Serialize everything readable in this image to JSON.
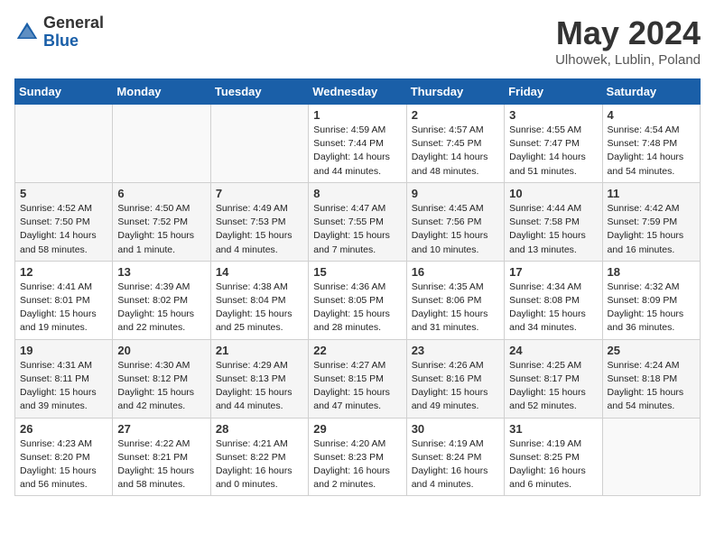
{
  "header": {
    "logo_general": "General",
    "logo_blue": "Blue",
    "month_title": "May 2024",
    "location": "Ulhowek, Lublin, Poland"
  },
  "weekdays": [
    "Sunday",
    "Monday",
    "Tuesday",
    "Wednesday",
    "Thursday",
    "Friday",
    "Saturday"
  ],
  "weeks": [
    [
      {
        "day": "",
        "info": ""
      },
      {
        "day": "",
        "info": ""
      },
      {
        "day": "",
        "info": ""
      },
      {
        "day": "1",
        "info": "Sunrise: 4:59 AM\nSunset: 7:44 PM\nDaylight: 14 hours\nand 44 minutes."
      },
      {
        "day": "2",
        "info": "Sunrise: 4:57 AM\nSunset: 7:45 PM\nDaylight: 14 hours\nand 48 minutes."
      },
      {
        "day": "3",
        "info": "Sunrise: 4:55 AM\nSunset: 7:47 PM\nDaylight: 14 hours\nand 51 minutes."
      },
      {
        "day": "4",
        "info": "Sunrise: 4:54 AM\nSunset: 7:48 PM\nDaylight: 14 hours\nand 54 minutes."
      }
    ],
    [
      {
        "day": "5",
        "info": "Sunrise: 4:52 AM\nSunset: 7:50 PM\nDaylight: 14 hours\nand 58 minutes."
      },
      {
        "day": "6",
        "info": "Sunrise: 4:50 AM\nSunset: 7:52 PM\nDaylight: 15 hours\nand 1 minute."
      },
      {
        "day": "7",
        "info": "Sunrise: 4:49 AM\nSunset: 7:53 PM\nDaylight: 15 hours\nand 4 minutes."
      },
      {
        "day": "8",
        "info": "Sunrise: 4:47 AM\nSunset: 7:55 PM\nDaylight: 15 hours\nand 7 minutes."
      },
      {
        "day": "9",
        "info": "Sunrise: 4:45 AM\nSunset: 7:56 PM\nDaylight: 15 hours\nand 10 minutes."
      },
      {
        "day": "10",
        "info": "Sunrise: 4:44 AM\nSunset: 7:58 PM\nDaylight: 15 hours\nand 13 minutes."
      },
      {
        "day": "11",
        "info": "Sunrise: 4:42 AM\nSunset: 7:59 PM\nDaylight: 15 hours\nand 16 minutes."
      }
    ],
    [
      {
        "day": "12",
        "info": "Sunrise: 4:41 AM\nSunset: 8:01 PM\nDaylight: 15 hours\nand 19 minutes."
      },
      {
        "day": "13",
        "info": "Sunrise: 4:39 AM\nSunset: 8:02 PM\nDaylight: 15 hours\nand 22 minutes."
      },
      {
        "day": "14",
        "info": "Sunrise: 4:38 AM\nSunset: 8:04 PM\nDaylight: 15 hours\nand 25 minutes."
      },
      {
        "day": "15",
        "info": "Sunrise: 4:36 AM\nSunset: 8:05 PM\nDaylight: 15 hours\nand 28 minutes."
      },
      {
        "day": "16",
        "info": "Sunrise: 4:35 AM\nSunset: 8:06 PM\nDaylight: 15 hours\nand 31 minutes."
      },
      {
        "day": "17",
        "info": "Sunrise: 4:34 AM\nSunset: 8:08 PM\nDaylight: 15 hours\nand 34 minutes."
      },
      {
        "day": "18",
        "info": "Sunrise: 4:32 AM\nSunset: 8:09 PM\nDaylight: 15 hours\nand 36 minutes."
      }
    ],
    [
      {
        "day": "19",
        "info": "Sunrise: 4:31 AM\nSunset: 8:11 PM\nDaylight: 15 hours\nand 39 minutes."
      },
      {
        "day": "20",
        "info": "Sunrise: 4:30 AM\nSunset: 8:12 PM\nDaylight: 15 hours\nand 42 minutes."
      },
      {
        "day": "21",
        "info": "Sunrise: 4:29 AM\nSunset: 8:13 PM\nDaylight: 15 hours\nand 44 minutes."
      },
      {
        "day": "22",
        "info": "Sunrise: 4:27 AM\nSunset: 8:15 PM\nDaylight: 15 hours\nand 47 minutes."
      },
      {
        "day": "23",
        "info": "Sunrise: 4:26 AM\nSunset: 8:16 PM\nDaylight: 15 hours\nand 49 minutes."
      },
      {
        "day": "24",
        "info": "Sunrise: 4:25 AM\nSunset: 8:17 PM\nDaylight: 15 hours\nand 52 minutes."
      },
      {
        "day": "25",
        "info": "Sunrise: 4:24 AM\nSunset: 8:18 PM\nDaylight: 15 hours\nand 54 minutes."
      }
    ],
    [
      {
        "day": "26",
        "info": "Sunrise: 4:23 AM\nSunset: 8:20 PM\nDaylight: 15 hours\nand 56 minutes."
      },
      {
        "day": "27",
        "info": "Sunrise: 4:22 AM\nSunset: 8:21 PM\nDaylight: 15 hours\nand 58 minutes."
      },
      {
        "day": "28",
        "info": "Sunrise: 4:21 AM\nSunset: 8:22 PM\nDaylight: 16 hours\nand 0 minutes."
      },
      {
        "day": "29",
        "info": "Sunrise: 4:20 AM\nSunset: 8:23 PM\nDaylight: 16 hours\nand 2 minutes."
      },
      {
        "day": "30",
        "info": "Sunrise: 4:19 AM\nSunset: 8:24 PM\nDaylight: 16 hours\nand 4 minutes."
      },
      {
        "day": "31",
        "info": "Sunrise: 4:19 AM\nSunset: 8:25 PM\nDaylight: 16 hours\nand 6 minutes."
      },
      {
        "day": "",
        "info": ""
      }
    ]
  ]
}
